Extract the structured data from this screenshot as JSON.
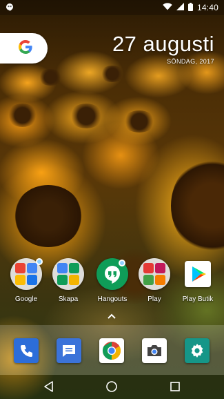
{
  "status_bar": {
    "time": "14:40",
    "icons": [
      "hangouts-notification-icon",
      "wifi-icon",
      "signal-icon",
      "battery-icon"
    ]
  },
  "search_widget": {
    "icon": "google-g-icon"
  },
  "date_widget": {
    "date": "27 augusti",
    "weekday_year": "SÖNDAG, 2017"
  },
  "apps": [
    {
      "label": "Google",
      "type": "folder",
      "badge": true
    },
    {
      "label": "Skapa",
      "type": "folder",
      "badge": false
    },
    {
      "label": "Hangouts",
      "type": "app",
      "badge": true,
      "color": "#0f9d58"
    },
    {
      "label": "Play",
      "type": "folder",
      "badge": false
    },
    {
      "label": "Play Butik",
      "type": "app",
      "badge": false
    }
  ],
  "app_drawer": {
    "icon": "chevron-up-icon"
  },
  "dock": [
    {
      "name": "phone",
      "icon": "phone-icon",
      "color": "#2c6dd8"
    },
    {
      "name": "messages",
      "icon": "messages-icon",
      "color": "#3b73d9"
    },
    {
      "name": "chrome",
      "icon": "chrome-icon",
      "color": "#ffffff"
    },
    {
      "name": "camera",
      "icon": "camera-icon",
      "color": "#ffffff"
    },
    {
      "name": "settings",
      "icon": "settings-icon",
      "color": "#159688"
    }
  ],
  "nav_bar": {
    "buttons": [
      "back-icon",
      "home-icon",
      "recents-icon"
    ]
  },
  "colors": {
    "hangouts_green": "#0f9d58",
    "badge_blue": "#8fd0ff",
    "settings_teal": "#159688",
    "phone_blue": "#2c6dd8"
  }
}
